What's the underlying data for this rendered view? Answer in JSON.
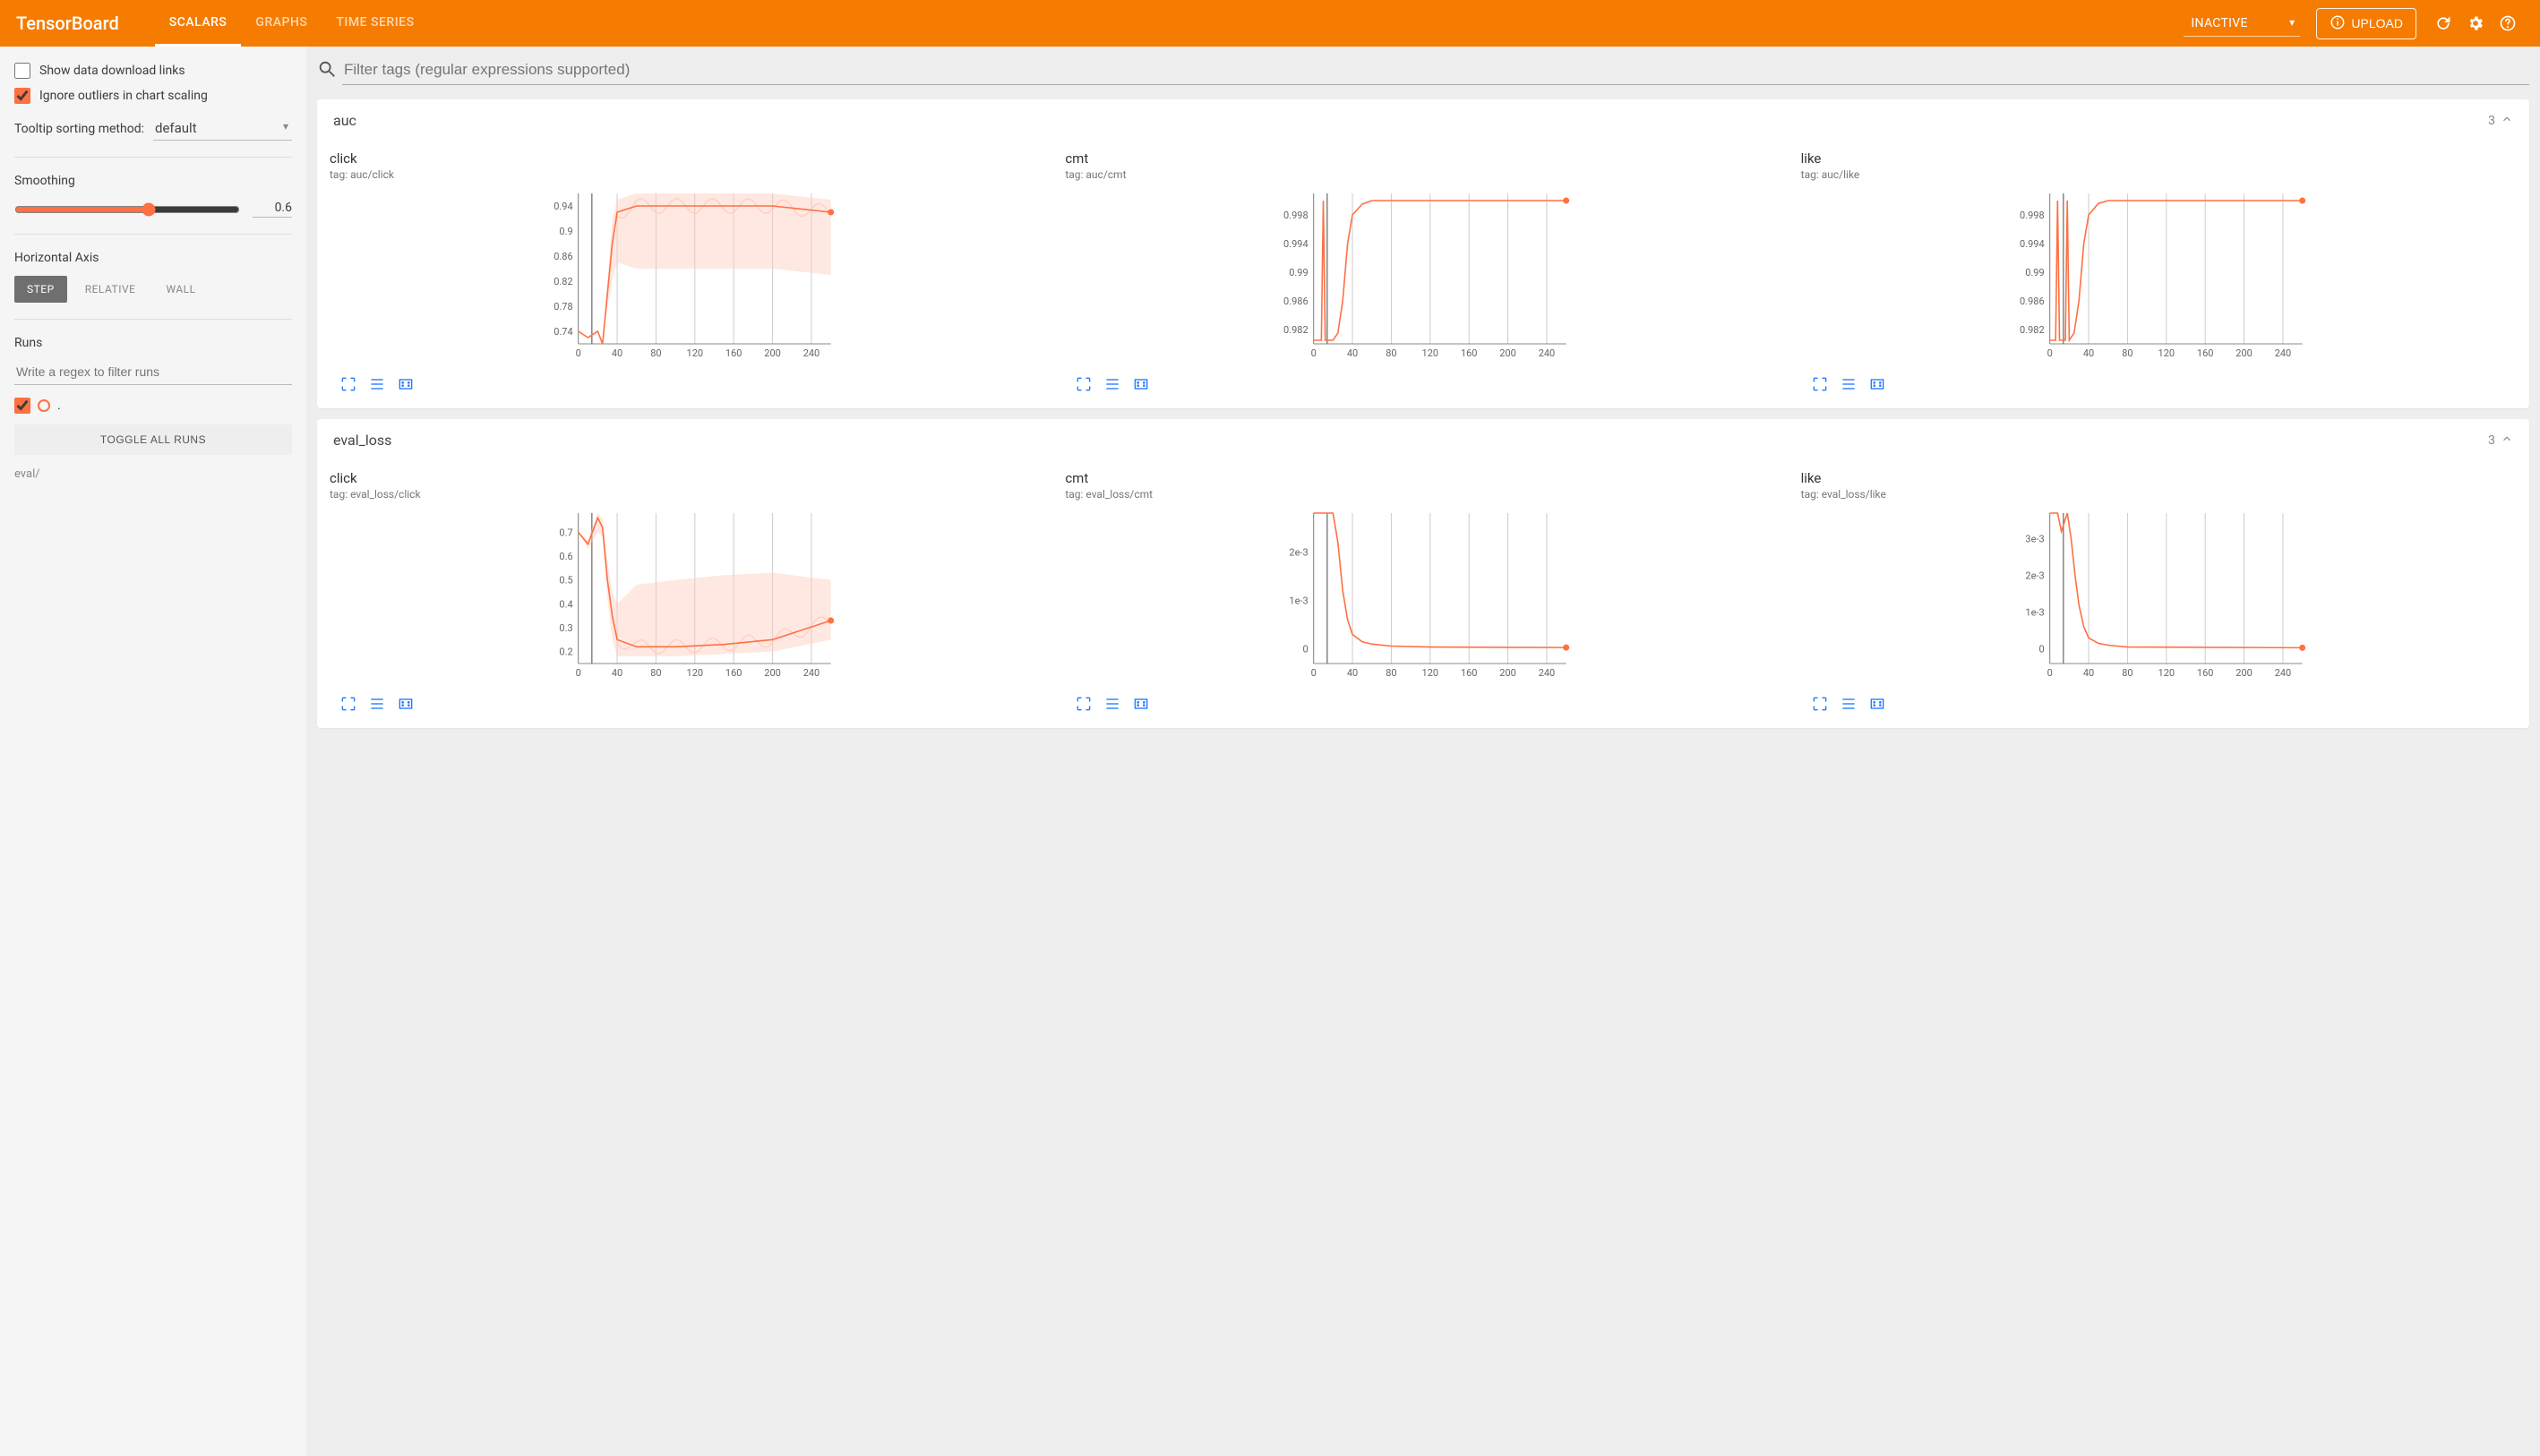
{
  "brand": "TensorBoard",
  "header": {
    "tabs": [
      {
        "label": "SCALARS",
        "active": true
      },
      {
        "label": "GRAPHS",
        "active": false
      },
      {
        "label": "TIME SERIES",
        "active": false
      }
    ],
    "inactive_label": "INACTIVE",
    "upload_label": "UPLOAD"
  },
  "sidebar": {
    "show_download_label": "Show data download links",
    "show_download_checked": false,
    "ignore_outliers_label": "Ignore outliers in chart scaling",
    "ignore_outliers_checked": true,
    "tooltip_label": "Tooltip sorting method:",
    "tooltip_value": "default",
    "smoothing_label": "Smoothing",
    "smoothing_value": "0.6",
    "haxis_label": "Horizontal Axis",
    "haxis_options": [
      {
        "label": "STEP",
        "active": true
      },
      {
        "label": "RELATIVE",
        "active": false
      },
      {
        "label": "WALL",
        "active": false
      }
    ],
    "runs_label": "Runs",
    "runs_filter_placeholder": "Write a regex to filter runs",
    "run_checked": true,
    "run_name": ".",
    "toggle_all_label": "TOGGLE ALL RUNS",
    "eval_label": "eval/"
  },
  "filter_placeholder": "Filter tags (regular expressions supported)",
  "sections": [
    {
      "id": "auc",
      "title": "auc",
      "count": "3",
      "cards": [
        {
          "title": "click",
          "tag": "tag: auc/click",
          "chart_ref": 0
        },
        {
          "title": "cmt",
          "tag": "tag: auc/cmt",
          "chart_ref": 1
        },
        {
          "title": "like",
          "tag": "tag: auc/like",
          "chart_ref": 2
        }
      ]
    },
    {
      "id": "eval_loss",
      "title": "eval_loss",
      "count": "3",
      "cards": [
        {
          "title": "click",
          "tag": "tag: eval_loss/click",
          "chart_ref": 3
        },
        {
          "title": "cmt",
          "tag": "tag: eval_loss/cmt",
          "chart_ref": 4
        },
        {
          "title": "like",
          "tag": "tag: eval_loss/like",
          "chart_ref": 5
        }
      ]
    }
  ],
  "chart_data": [
    {
      "type": "line",
      "title": "auc/click",
      "xlabel": "step",
      "ylabel": "auc",
      "x_ticks": [
        0,
        40,
        80,
        120,
        160,
        200,
        240
      ],
      "y_ticks": [
        0.74,
        0.78,
        0.82,
        0.86,
        0.9,
        0.94
      ],
      "xlim": [
        0,
        260
      ],
      "ylim": [
        0.72,
        0.96
      ],
      "vline_x": 14,
      "series": [
        {
          "name": "eval/",
          "x": [
            0,
            10,
            20,
            25,
            30,
            35,
            40,
            60,
            100,
            150,
            200,
            260
          ],
          "values": [
            0.74,
            0.73,
            0.74,
            0.72,
            0.8,
            0.88,
            0.93,
            0.94,
            0.94,
            0.94,
            0.94,
            0.93
          ],
          "band_lo": [
            0.74,
            0.73,
            0.74,
            0.72,
            0.78,
            0.82,
            0.85,
            0.84,
            0.84,
            0.84,
            0.84,
            0.83
          ],
          "band_hi": [
            0.74,
            0.73,
            0.74,
            0.72,
            0.82,
            0.92,
            0.95,
            0.96,
            0.96,
            0.96,
            0.96,
            0.95
          ],
          "oscillate_from_x": 40,
          "oscillate_amp": 0.012
        }
      ]
    },
    {
      "type": "line",
      "title": "auc/cmt",
      "xlabel": "step",
      "ylabel": "auc",
      "x_ticks": [
        0,
        40,
        80,
        120,
        160,
        200,
        240
      ],
      "y_ticks": [
        0.982,
        0.986,
        0.99,
        0.994,
        0.998
      ],
      "xlim": [
        0,
        260
      ],
      "ylim": [
        0.98,
        1.001
      ],
      "vline_x": 14,
      "series": [
        {
          "name": "eval/",
          "x": [
            0,
            8,
            10,
            12,
            20,
            25,
            30,
            35,
            40,
            50,
            60,
            100,
            260
          ],
          "values": [
            0.9805,
            0.9805,
            1.0,
            0.9805,
            0.9805,
            0.9815,
            0.986,
            0.994,
            0.998,
            0.9995,
            1.0,
            1.0,
            1.0
          ]
        }
      ]
    },
    {
      "type": "line",
      "title": "auc/like",
      "xlabel": "step",
      "ylabel": "auc",
      "x_ticks": [
        0,
        40,
        80,
        120,
        160,
        200,
        240
      ],
      "y_ticks": [
        0.982,
        0.986,
        0.99,
        0.994,
        0.998
      ],
      "xlim": [
        0,
        260
      ],
      "ylim": [
        0.98,
        1.001
      ],
      "vline_x": 14,
      "series": [
        {
          "name": "eval/",
          "x": [
            0,
            6,
            8,
            10,
            16,
            18,
            20,
            25,
            30,
            35,
            40,
            50,
            60,
            260
          ],
          "values": [
            0.9805,
            0.9805,
            1.0,
            0.9805,
            0.9805,
            1.0,
            0.9805,
            0.9815,
            0.986,
            0.994,
            0.998,
            0.9996,
            1.0,
            1.0
          ]
        }
      ]
    },
    {
      "type": "line",
      "title": "eval_loss/click",
      "xlabel": "step",
      "ylabel": "loss",
      "x_ticks": [
        0,
        40,
        80,
        120,
        160,
        200,
        240
      ],
      "y_ticks": [
        0.2,
        0.3,
        0.4,
        0.5,
        0.6,
        0.7
      ],
      "xlim": [
        0,
        260
      ],
      "ylim": [
        0.15,
        0.78
      ],
      "vline_x": 14,
      "series": [
        {
          "name": "eval/",
          "x": [
            0,
            10,
            20,
            25,
            30,
            35,
            40,
            60,
            100,
            150,
            200,
            260
          ],
          "values": [
            0.7,
            0.65,
            0.76,
            0.72,
            0.5,
            0.35,
            0.25,
            0.22,
            0.22,
            0.23,
            0.25,
            0.33
          ],
          "band_lo": [
            0.7,
            0.63,
            0.7,
            0.68,
            0.42,
            0.25,
            0.18,
            0.18,
            0.18,
            0.19,
            0.2,
            0.25
          ],
          "band_hi": [
            0.7,
            0.67,
            0.78,
            0.76,
            0.58,
            0.45,
            0.4,
            0.48,
            0.5,
            0.52,
            0.53,
            0.5
          ],
          "oscillate_from_x": 40,
          "oscillate_amp": 0.03
        }
      ]
    },
    {
      "type": "line",
      "title": "eval_loss/cmt",
      "xlabel": "step",
      "ylabel": "loss",
      "x_ticks": [
        0,
        40,
        80,
        120,
        160,
        200,
        240
      ],
      "y_ticks_labels": [
        "0",
        "1e-3",
        "2e-3"
      ],
      "y_ticks": [
        0,
        0.001,
        0.002
      ],
      "xlim": [
        0,
        260
      ],
      "ylim": [
        -0.0003,
        0.0028
      ],
      "vline_x": 14,
      "series": [
        {
          "name": "eval/",
          "x": [
            0,
            10,
            20,
            25,
            30,
            35,
            40,
            50,
            60,
            80,
            120,
            260
          ],
          "values": [
            0.0028,
            0.0028,
            0.0028,
            0.0022,
            0.0012,
            0.0006,
            0.0003,
            0.00015,
            0.0001,
            6e-05,
            4e-05,
            3e-05
          ]
        }
      ]
    },
    {
      "type": "line",
      "title": "eval_loss/like",
      "xlabel": "step",
      "ylabel": "loss",
      "x_ticks": [
        0,
        40,
        80,
        120,
        160,
        200,
        240
      ],
      "y_ticks_labels": [
        "0",
        "1e-3",
        "2e-3",
        "3e-3"
      ],
      "y_ticks": [
        0,
        0.001,
        0.002,
        0.003
      ],
      "xlim": [
        0,
        260
      ],
      "ylim": [
        -0.0004,
        0.0037
      ],
      "vline_x": 14,
      "series": [
        {
          "name": "eval/",
          "x": [
            0,
            8,
            12,
            18,
            22,
            26,
            30,
            35,
            40,
            50,
            60,
            80,
            260
          ],
          "values": [
            0.0037,
            0.0037,
            0.0032,
            0.0037,
            0.003,
            0.002,
            0.0012,
            0.0006,
            0.0003,
            0.00015,
            0.0001,
            5e-05,
            3e-05
          ]
        }
      ]
    }
  ]
}
